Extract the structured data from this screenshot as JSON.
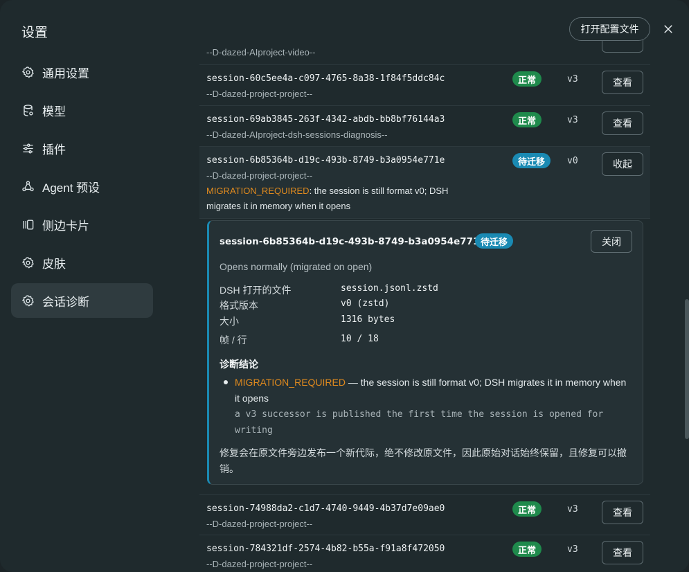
{
  "modal": {
    "title": "设置",
    "open_config_label": "打开配置文件"
  },
  "sidebar": {
    "items": [
      {
        "label": "通用设置",
        "icon": "gear-icon"
      },
      {
        "label": "模型",
        "icon": "database-icon"
      },
      {
        "label": "插件",
        "icon": "sliders-icon"
      },
      {
        "label": "Agent 预设",
        "icon": "agent-icon"
      },
      {
        "label": "侧边卡片",
        "icon": "panel-icon"
      },
      {
        "label": "皮肤",
        "icon": "gear-icon"
      },
      {
        "label": "会话诊断",
        "icon": "gear-icon",
        "active": true
      }
    ]
  },
  "sessions": {
    "partial_top_path": "--D-dazed-AIproject-video--",
    "rows": [
      {
        "id": "session-60c5ee4a-c097-4765-8a38-1f84f5ddc84c",
        "path": "--D-dazed-project-project--",
        "status": "正常",
        "version": "v3",
        "action": "查看"
      },
      {
        "id": "session-69ab3845-263f-4342-abdb-bb8bf76144a3",
        "path": "--D-dazed-AIproject-dsh-sessions-diagnosis--",
        "status": "正常",
        "version": "v3",
        "action": "查看"
      },
      {
        "id": "session-6b85364b-d19c-493b-8749-b3a0954e771e",
        "path": "--D-dazed-project-project--",
        "status": "待迁移",
        "version": "v0",
        "action": "收起",
        "warning_code": "MIGRATION_REQUIRED",
        "warning_text": ": the session is still format v0; DSH migrates it in memory when it opens"
      },
      {
        "id": "session-74988da2-c1d7-4740-9449-4b37d7e09ae0",
        "path": "--D-dazed-project-project--",
        "status": "正常",
        "version": "v3",
        "action": "查看"
      },
      {
        "id": "session-784321df-2574-4b82-b55a-f91a8f472050",
        "path": "--D-dazed-project-project--",
        "status": "正常",
        "version": "v3",
        "action": "查看"
      }
    ]
  },
  "detail": {
    "title": "session-6b85364b-d19c-493b-8749-b3a0954e771e",
    "badge": "待迁移",
    "close_label": "关闭",
    "subtitle": "Opens normally (migrated on open)",
    "fields": [
      {
        "key": "DSH 打开的文件",
        "value": "session.jsonl.zstd"
      },
      {
        "key": "格式版本",
        "value": "v0 (zstd)"
      },
      {
        "key": "大小",
        "value": "1316 bytes"
      },
      {
        "key": "帧 / 行",
        "value": "10 / 18"
      }
    ],
    "diagnosis_heading": "诊断结论",
    "diagnosis_code": "MIGRATION_REQUIRED",
    "diagnosis_text": " — the session is still format v0; DSH migrates it in memory when it opens",
    "diagnosis_detail": "a v3 successor is published the first time the session is opened for writing",
    "fix_note": "修复会在原文件旁边发布一个新代际，绝不修改原文件，因此原始对话始终保留，且修复可以撤销。"
  },
  "colors": {
    "ok_badge": "#1f8a4c",
    "pending_badge": "#1a8ab3",
    "warning_code": "#e08a1e"
  }
}
